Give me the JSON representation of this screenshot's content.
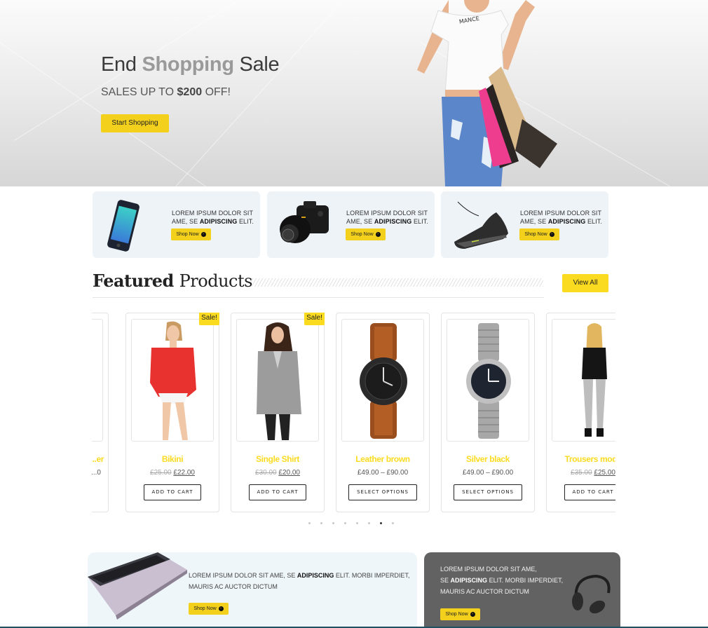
{
  "hero": {
    "title_pre": "End",
    "title_highlight": "Shopping",
    "title_post": "Sale",
    "subtitle_pre": "SALES UP TO",
    "subtitle_amount": "$200",
    "subtitle_post": "OFF!",
    "cta_label": "Start Shopping"
  },
  "promos": [
    {
      "product": "smartphone",
      "text_pre": "LOREM IPSUM DOLOR SIT AME, SE",
      "text_bold": "ADIPISCING",
      "text_post": "ELIT.",
      "button": "Shop Now"
    },
    {
      "product": "camera",
      "text_pre": "LOREM IPSUM DOLOR SIT AME, SE",
      "text_bold": "ADIPISCING",
      "text_post": "ELIT.",
      "button": "Shop Now"
    },
    {
      "product": "sneaker",
      "text_pre": "LOREM IPSUM DOLOR SIT AME, SE",
      "text_bold": "ADIPISCING",
      "text_post": "ELIT.",
      "button": "Shop Now"
    }
  ],
  "featured": {
    "title_bold": "Featured",
    "title_regular": "Products",
    "view_all": "View All",
    "products": [
      {
        "name": "...er",
        "price_text": "...0",
        "button": ""
      },
      {
        "name": "Bikini",
        "old_price": "£25.00",
        "new_price": "£22.00",
        "sale_badge": "Sale!",
        "button": "ADD TO CART"
      },
      {
        "name": "Single Shirt",
        "old_price": "£30.00",
        "new_price": "£20.00",
        "sale_badge": "Sale!",
        "button": "ADD TO CART"
      },
      {
        "name": "Leather brown",
        "price_range": "£49.00 – £90.00",
        "button": "SELECT OPTIONS"
      },
      {
        "name": "Silver black",
        "price_range": "£49.00 – £90.00",
        "button": "SELECT OPTIONS"
      },
      {
        "name": "Trousers mode",
        "old_price": "£35.00",
        "new_price": "£25.00",
        "button": "ADD TO CART"
      }
    ],
    "pagination": {
      "total": 8,
      "active_index": 6
    }
  },
  "banners": {
    "left": {
      "text_pre": "LOREM IPSUM DOLOR SIT AME, SE",
      "text_bold": "ADIPISCING",
      "text_post": "ELIT. MORBI IMPERDIET, MAURIS AC AUCTOR DICTUM",
      "button": "Shop Now",
      "product": "laptop"
    },
    "right": {
      "line1": "LOREM IPSUM DOLOR SIT AME,",
      "text_pre": "SE",
      "text_bold": "ADIPISCING",
      "text_post": "ELIT. MORBI IMPERDIET,",
      "line3": "MAURIS AC AUCTOR DICTUM",
      "button": "Shop Now",
      "product": "headphones"
    }
  },
  "colors": {
    "accent": "#f2d01c",
    "product_name": "#fbdb1f",
    "promo_bg": "#eef3f8",
    "dark_banner": "#626262"
  }
}
